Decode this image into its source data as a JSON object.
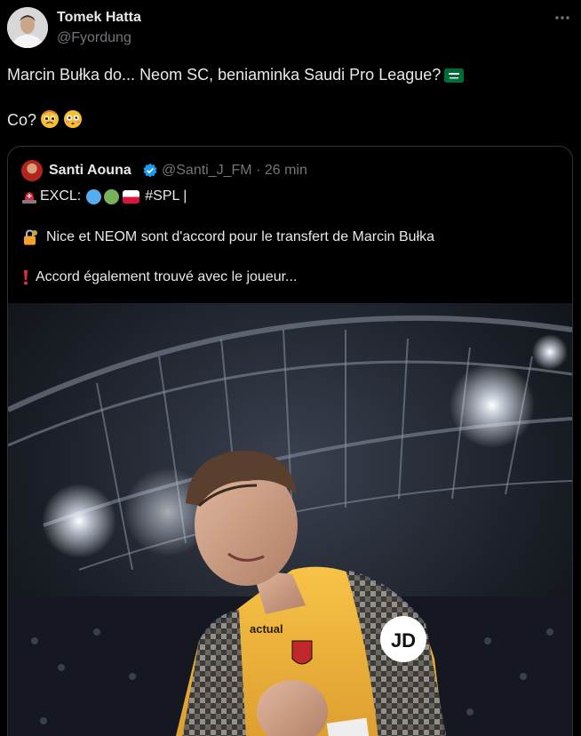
{
  "post": {
    "author_name": "Tomek Hatta",
    "author_handle": "@Fyordung",
    "line1": "Marcin Bułka do... Neom SC, beniaminka Saudi Pro League?",
    "line2": "Co?",
    "emoji_line1": [
      "flag-saudi-arabia-icon"
    ],
    "emoji_line2": [
      "pleading-face-icon",
      "flushed-face-icon"
    ]
  },
  "quote": {
    "author_name": "Santi Aouna",
    "author_handle": "@Santi_J_FM",
    "separator": "·",
    "time": "26 min",
    "verified": true,
    "line1_prefix": "EXCL:",
    "line1_suffix": "#SPL |",
    "line2": "Nice et NEOM sont d'accord pour le transfert de Marcin Bułka",
    "line3": "Accord également trouvé avec le joueur...",
    "media": {
      "jersey_sponsor": "actual",
      "sleeve_logo": "JD"
    }
  },
  "colors": {
    "background": "#000000",
    "text_primary": "#e7e9ea",
    "text_secondary": "#71767b",
    "border": "#2f3336",
    "verified_blue": "#1d9bf0",
    "jersey_yellow": "#f2b632"
  }
}
